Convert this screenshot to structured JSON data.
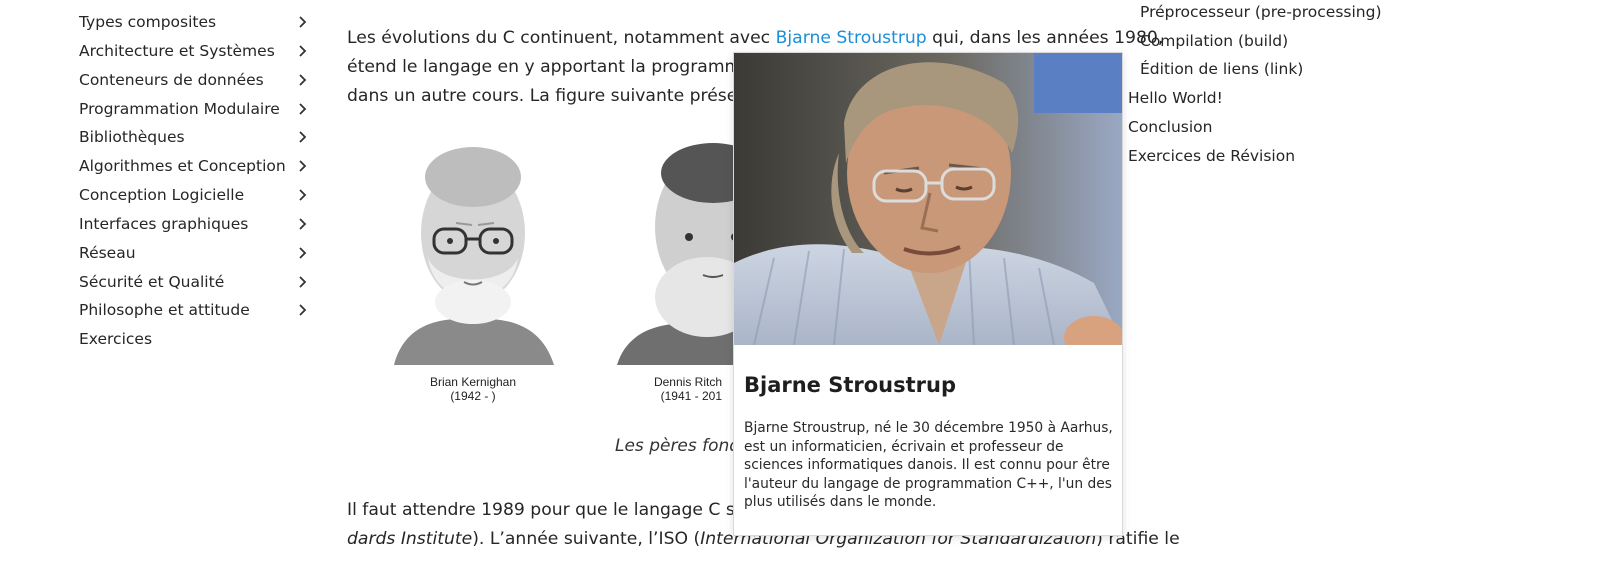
{
  "sidebar": {
    "items": [
      {
        "label": "Types composites",
        "has_children": true
      },
      {
        "label": "Architecture et Systèmes",
        "has_children": true
      },
      {
        "label": "Conteneurs de données",
        "has_children": true
      },
      {
        "label": "Programmation Modulaire",
        "has_children": true
      },
      {
        "label": "Bibliothèques",
        "has_children": true
      },
      {
        "label": "Algorithmes et Conception",
        "has_children": true
      },
      {
        "label": "Conception Logicielle",
        "has_children": true
      },
      {
        "label": "Interfaces graphiques",
        "has_children": true
      },
      {
        "label": "Réseau",
        "has_children": true
      },
      {
        "label": "Sécurité et Qualité",
        "has_children": true
      },
      {
        "label": "Philosophe et attitude",
        "has_children": true
      },
      {
        "label": "Exercices",
        "has_children": false
      }
    ]
  },
  "main": {
    "p1": {
      "line1_before": "Les évolutions du C continuent, notamment avec ",
      "line1_link": "Bjarne Stroustrup",
      "line1_after": " qui, dans les années 1980,",
      "line2": "étend le langage en y apportant la programmation",
      "line3": "dans un autre cours. La figure suivante présente le"
    },
    "figure": {
      "people": [
        {
          "name": "Brian Kernighan",
          "years": "(1942 - )"
        },
        {
          "name": "Dennis Ritch",
          "years": "(1941 - 201"
        }
      ],
      "caption": "Les pères fonda"
    },
    "p2": {
      "line1": "Il faut attendre 1989 pour que le langage C soit n",
      "line2_italic1": "dards Institute",
      "line2_mid": "). L’année suivante, l’ISO (",
      "line2_italic2": "International Organization for Standardization",
      "line2_end": ") ratifie le"
    }
  },
  "toc": {
    "sub_items": [
      {
        "label": "Préprocesseur (pre-processing)"
      },
      {
        "label": "Compilation (build)"
      },
      {
        "label": "Édition de liens (link)"
      }
    ],
    "items": [
      {
        "label": "Hello World!"
      },
      {
        "label": "Conclusion"
      },
      {
        "label": "Exercices de Révision"
      }
    ]
  },
  "popup": {
    "title": "Bjarne Stroustrup",
    "description": "Bjarne Stroustrup, né le 30 décembre 1950 à Aarhus, est un informaticien, écrivain et professeur de sciences informatiques danois. Il est connu pour être l'auteur du langage de programmation C++, l'un des plus utilisés dans le monde."
  },
  "colors": {
    "link": "#1a8fd8",
    "text": "#262626"
  }
}
